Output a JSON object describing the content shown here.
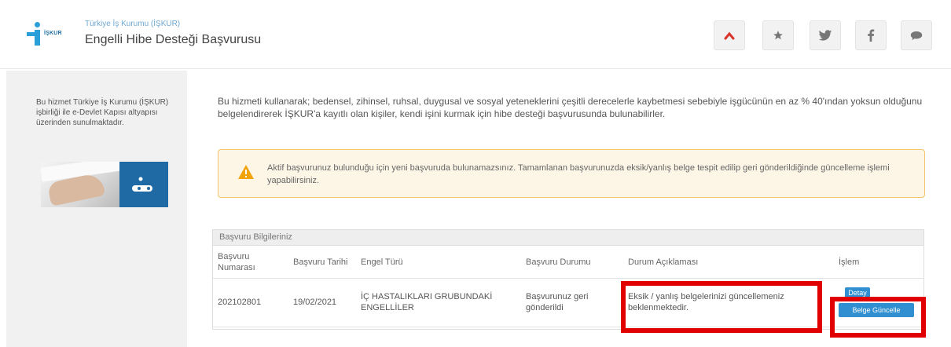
{
  "header": {
    "org_name": "Türkiye İş Kurumu (İŞKUR)",
    "service_title": "Engelli Hibe Desteği Başvurusu",
    "logo_text": "İŞKUR",
    "social_icons": [
      "up-icon",
      "star-icon",
      "twitter-icon",
      "facebook-icon",
      "comment-icon"
    ]
  },
  "sidebar": {
    "text": "Bu hizmet Türkiye İş Kurumu (İŞKUR) işbirliği ile e-Devlet Kapısı altyapısı üzerinden sunulmaktadır."
  },
  "main": {
    "intro": "Bu hizmeti kullanarak; bedensel, zihinsel, ruhsal, duygusal ve sosyal yeteneklerini çeşitli derecelerle kaybetmesi sebebiyle işgücünün en az % 40'ından yoksun olduğunu belgelendirerek İŞKUR'a kayıtlı olan kişiler, kendi işini kurmak için hibe desteği başvurusunda bulunabilirler.",
    "alert": "Aktif başvurunuz bulunduğu için yeni başvuruda bulunamazsınız. Tamamlanan başvurunuzda eksik/yanlış belge tespit edilip geri gönderildiğinde güncelleme işlemi yapabilirsiniz."
  },
  "panel": {
    "title": "Başvuru Bilgileriniz",
    "columns": {
      "no": "Başvuru Numarası",
      "date": "Başvuru Tarihi",
      "type": "Engel Türü",
      "status": "Başvuru Durumu",
      "desc": "Durum Açıklaması",
      "action": "İşlem"
    },
    "row": {
      "no": "202102801",
      "date": "19/02/2021",
      "type": "İÇ HASTALIKLARI GRUBUNDAKİ ENGELLİLER",
      "status": "Başvurunuz geri gönderildi",
      "desc": "Eksik / yanlış belgelerinizi güncellemeniz beklenmektedir.",
      "detail_button": "Detay",
      "update_button": "Belge Güncelle"
    }
  },
  "colors": {
    "accent": "#2f8fd0",
    "highlight": "#e00000",
    "alert_bg": "#fdf6e7",
    "alert_border": "#f0c56b"
  }
}
